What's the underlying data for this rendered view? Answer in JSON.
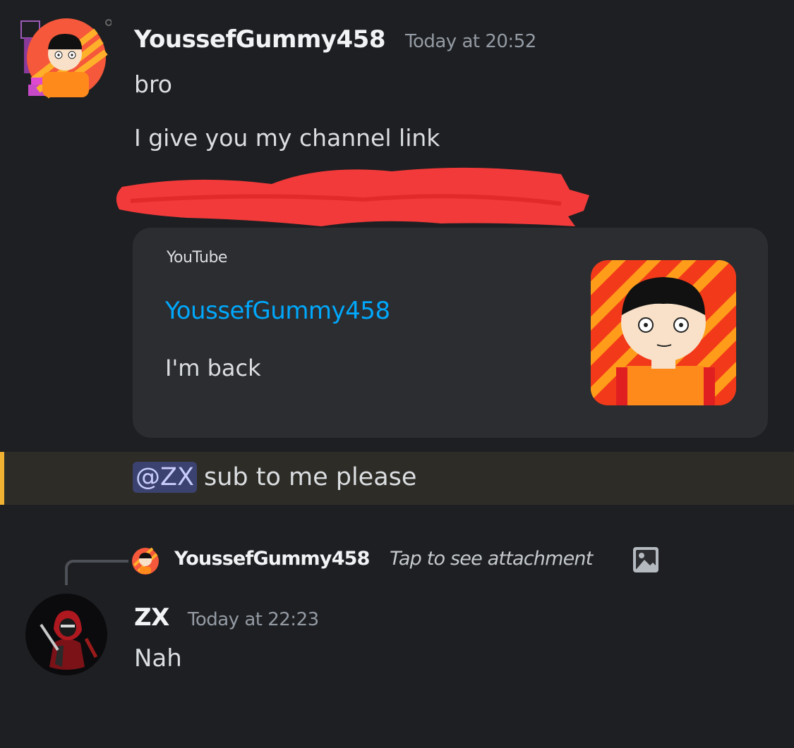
{
  "messages": [
    {
      "author": "YoussefGummy458",
      "timestamp": "Today at 20:52",
      "lines": [
        "bro",
        "I give you my channel link"
      ],
      "embed": {
        "provider": "YouTube",
        "title": "YoussefGummy458",
        "description": "I'm back"
      },
      "mention": {
        "user": "@ZX",
        "text": "sub to me please"
      }
    },
    {
      "reply": {
        "author": "YoussefGummy458",
        "note": "Tap to see attachment"
      },
      "author": "ZX",
      "timestamp": "Today at 22:23",
      "lines": [
        "Nah"
      ]
    }
  ],
  "colors": {
    "background": "#1e1f22",
    "embed_background": "#2b2d31",
    "link": "#00a8fc",
    "mention_highlight": "#2e2c27",
    "mention_bar": "#f0b232",
    "redaction": "#f23a3a"
  },
  "icons": {
    "avatar_1": "avatar-youssef-icon",
    "avatar_2": "avatar-zx-icon",
    "reply_attachment": "image-icon"
  }
}
